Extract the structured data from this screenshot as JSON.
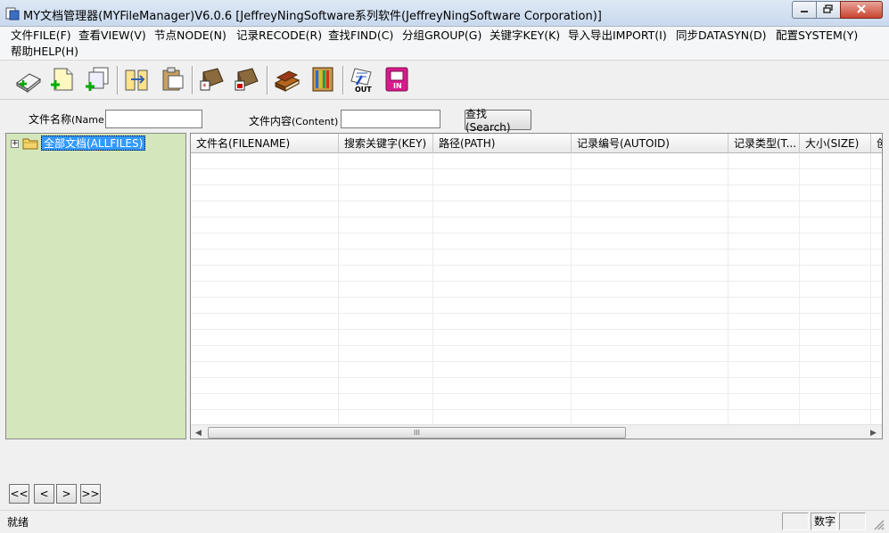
{
  "window": {
    "title": "MY文档管理器(MYFileManager)V6.0.6 [JeffreyNingSoftware系列软件(JeffreyNingSoftware Corporation)]"
  },
  "menu": [
    {
      "label": "文件FILE(F)"
    },
    {
      "label": "查看VIEW(V)"
    },
    {
      "label": "节点NODE(N)"
    },
    {
      "label": "记录RECODE(R)"
    },
    {
      "label": "查找FIND(C)"
    },
    {
      "label": "分组GROUP(G)"
    },
    {
      "label": "关键字KEY(K)"
    },
    {
      "label": "导入导出IMPORT(I)"
    },
    {
      "label": "同步DATASYN(D)"
    },
    {
      "label": "配置SYSTEM(Y)"
    },
    {
      "label": "帮助HELP(H)"
    }
  ],
  "toolbar": {
    "icons": [
      "add-node-icon",
      "add-file-icon",
      "add-copy-icon",
      "move-icon",
      "paste-icon",
      "folder-star-icon",
      "folder-calendar-icon",
      "books-icon",
      "shelf-icon",
      "export-out-icon",
      "import-in-icon"
    ],
    "export_text": "OUT",
    "import_text": "IN"
  },
  "search": {
    "name_label": "文件名称",
    "name_label_en": "(Name)",
    "name_value": "",
    "content_label": "文件内容",
    "content_label_en": "(Content)",
    "content_value": "",
    "button_label": "查找(Search)"
  },
  "tree": {
    "expander": "+",
    "root_label": "全部文档(ALLFILES)"
  },
  "grid": {
    "columns": [
      {
        "label": "文件名(FILENAME)"
      },
      {
        "label": "搜索关键字(KEY)"
      },
      {
        "label": "路径(PATH)"
      },
      {
        "label": "记录编号(AUTOID)"
      },
      {
        "label": "记录类型(T..."
      },
      {
        "label": "大小(SIZE)"
      },
      {
        "label": "创"
      }
    ],
    "rows": [],
    "scroll_thumb_grip": "III"
  },
  "nav": {
    "first": "<<",
    "prev": "<",
    "next": ">",
    "last": ">>"
  },
  "status": {
    "text": "就绪",
    "pane1": "",
    "pane2": "数字",
    "pane3": ""
  },
  "colors": {
    "tree_bg": "#d4e6bc",
    "selection": "#3399ff"
  }
}
